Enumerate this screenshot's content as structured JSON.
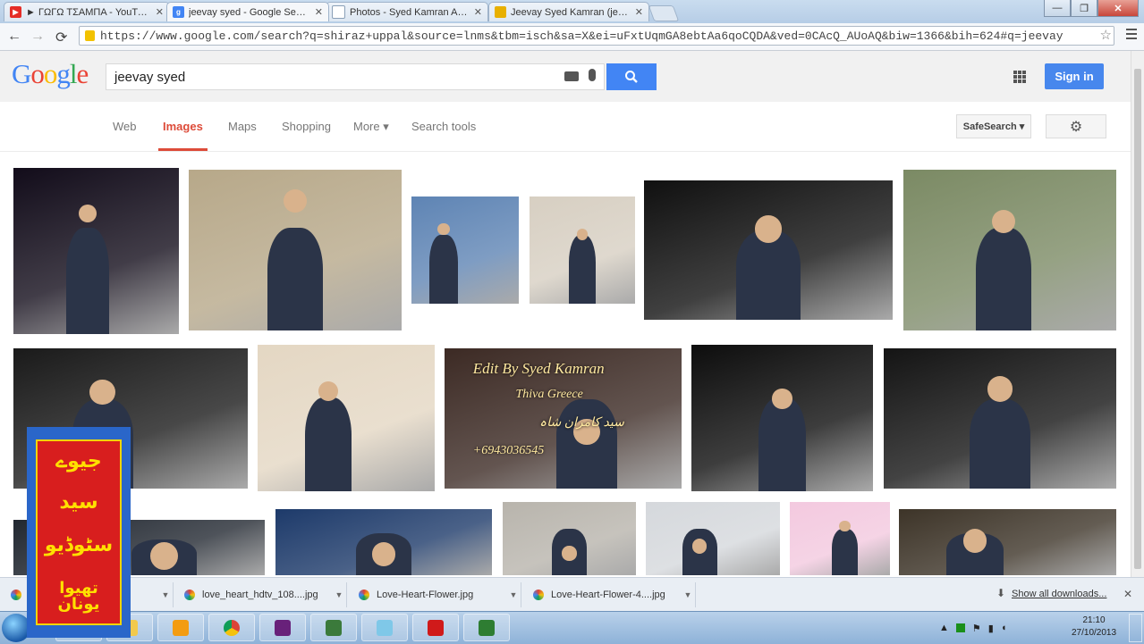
{
  "browser": {
    "tabs": [
      {
        "title": "► ΓΩΓΩ ΤΣΑΜΠΑ - YouTube",
        "favicon": "youtube-icon",
        "color": "#e52d27"
      },
      {
        "title": "jeevay syed - Google Search",
        "favicon": "google-icon",
        "color": "#4285f4"
      },
      {
        "title": "Photos - Syed Kamran Abbas",
        "favicon": "page-icon",
        "color": "#8aa0b8"
      },
      {
        "title": "Jeevay Syed Kamran (jeevay",
        "favicon": "lock-icon",
        "color": "#e8b000"
      }
    ],
    "window_buttons": {
      "minimize": "—",
      "maximize": "❐",
      "close": "✕"
    },
    "url": "https://www.google.com/search?q=shiraz+uppal&source=lnms&tbm=isch&sa=X&ei=uFxtUqmGA8ebtAa6qoCQDA&ved=0CAcQ_AUoAQ&biw=1366&bih=624#q=jeevay",
    "nav": {
      "back": "←",
      "forward": "→",
      "reload": "⟳"
    },
    "star": "☆"
  },
  "google": {
    "logo_letters": [
      {
        "ch": "G",
        "color": "#4285f4"
      },
      {
        "ch": "o",
        "color": "#ea4335"
      },
      {
        "ch": "o",
        "color": "#fbbc05"
      },
      {
        "ch": "g",
        "color": "#4285f4"
      },
      {
        "ch": "l",
        "color": "#34a853"
      },
      {
        "ch": "e",
        "color": "#ea4335"
      }
    ],
    "query": "jeevay syed",
    "signin_label": "Sign in",
    "nav_items": [
      "Web",
      "Images",
      "Maps",
      "Shopping",
      "More ▾",
      "Search tools"
    ],
    "active_nav": "Images",
    "safesearch_label": "SafeSearch ▾",
    "settings_icon": "⚙"
  },
  "results": {
    "overlay_text_1": "Edit By Syed Kamran",
    "overlay_text_2": "Thiva Greece",
    "overlay_text_3": "+6943036545",
    "overlay_urdu": "سید کامران شاہ",
    "thumbnails": [
      {
        "bg": "#120c1a"
      },
      {
        "bg": "#b7a889"
      },
      {
        "bg": "#5e84b4"
      },
      {
        "bg": "#d7cfc2"
      },
      {
        "bg": "#101010"
      },
      {
        "bg": "#7b8a64"
      },
      {
        "bg": "#1a1a1a"
      },
      {
        "bg": "#e4d7c3"
      },
      {
        "bg": "#3c2a24"
      },
      {
        "bg": "#0d0d0d"
      },
      {
        "bg": "#141414"
      },
      {
        "bg": "#222831"
      },
      {
        "bg": "#1d3a6a"
      },
      {
        "bg": "#b8b4ac"
      },
      {
        "bg": "#d5d8dc"
      },
      {
        "bg": "#f3c9df"
      },
      {
        "bg": "#3d3428"
      }
    ]
  },
  "overlay_logo": {
    "lines": [
      "جیوے",
      "سید",
      "سٹوڈیو",
      "تھیوا یونان"
    ]
  },
  "downloads": {
    "items": [
      "love_heart_hdtv_108....jpg",
      "Love-Heart-Flower.jpg",
      "Love-Heart-Flower-4....jpg"
    ],
    "show_all": "Show all downloads...",
    "close": "✕"
  },
  "taskbar": {
    "apps": [
      {
        "name": "ie-icon",
        "color": "#1e88e5"
      },
      {
        "name": "folder-icon",
        "color": "#f2c94c"
      },
      {
        "name": "media-player-icon",
        "color": "#f39c12"
      },
      {
        "name": "chrome-icon",
        "color": "#db4437"
      },
      {
        "name": "visual-studio-icon",
        "color": "#68217a"
      },
      {
        "name": "tool-icon",
        "color": "#3b7a3b"
      },
      {
        "name": "notepad-icon",
        "color": "#7fc8e8"
      },
      {
        "name": "adobe-icon",
        "color": "#d01a1a"
      },
      {
        "name": "monitor-icon",
        "color": "#2e7d32"
      }
    ],
    "time": "21:10",
    "date": "27/10/2013"
  }
}
